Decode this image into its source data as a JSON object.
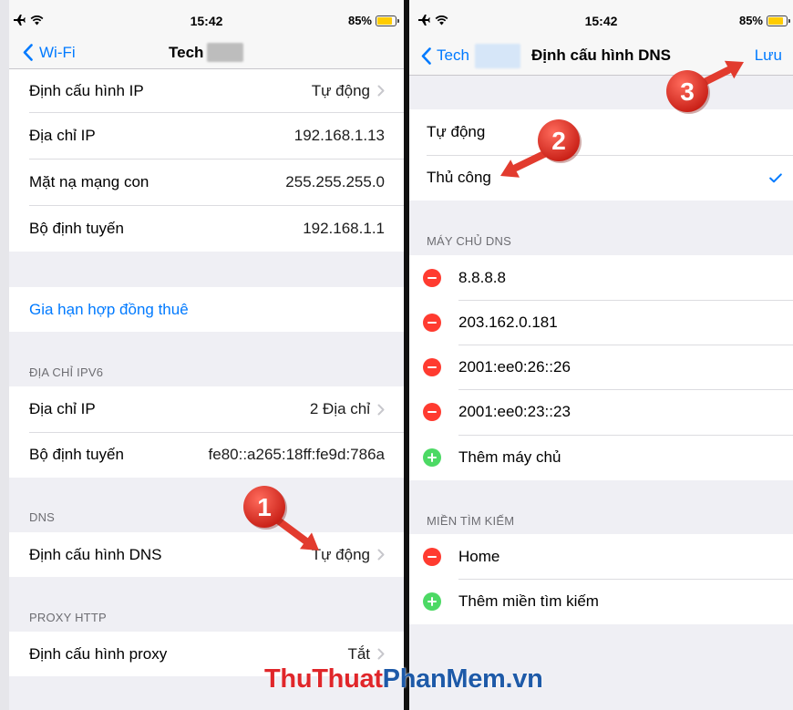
{
  "colors": {
    "ios_blue": "#007aff",
    "delete_red": "#ff3b30",
    "add_green": "#4cd964",
    "annotation_red": "#e23b2e",
    "battery_yellow": "#ffcc00",
    "group_background": "#efeff4",
    "section_header_gray": "#6d6d72",
    "watermark_red": "#e0262a",
    "watermark_blue": "#1e5aa8"
  },
  "icons": {
    "status_bar": [
      "airplane-mode-icon",
      "wifi-icon",
      "battery-icon"
    ],
    "navigation": [
      "chevron-left-icon",
      "chevron-right-icon",
      "checkmark-icon"
    ],
    "editing": [
      "delete-minus-icon",
      "add-plus-icon"
    ]
  },
  "left": {
    "status_bar": {
      "time": "15:42",
      "battery": "85%",
      "battery_level": 0.85
    },
    "nav": {
      "back_label": "Wi-Fi",
      "title": "Tech"
    },
    "ip_rows": [
      {
        "label": "Định cấu hình IP",
        "value": "Tự động"
      },
      {
        "label": "Địa chỉ IP",
        "value": "192.168.1.13"
      },
      {
        "label": "Mặt nạ mạng con",
        "value": "255.255.255.0"
      },
      {
        "label": "Bộ định tuyến",
        "value": "192.168.1.1"
      }
    ],
    "renew_lease_label": "Gia hạn hợp đồng thuê",
    "ipv6": {
      "header": "ĐỊA CHỈ IPV6",
      "rows": [
        {
          "label": "Địa chỉ IP",
          "value": "2 Địa chỉ"
        },
        {
          "label": "Bộ định tuyến",
          "value": "fe80::a265:18ff:fe9d:786a"
        }
      ]
    },
    "dns": {
      "header": "DNS",
      "row": {
        "label": "Định cấu hình DNS",
        "value": "Tự động"
      }
    },
    "proxy": {
      "header": "PROXY HTTP",
      "row": {
        "label": "Định cấu hình proxy",
        "value": "Tắt"
      }
    }
  },
  "right": {
    "status_bar": {
      "time": "15:42",
      "battery": "85%",
      "battery_level": 0.85
    },
    "nav": {
      "back_label": "Tech",
      "title": "Định cấu hình DNS",
      "save_label": "Lưu"
    },
    "mode_options": [
      {
        "label": "Tự động",
        "selected": false
      },
      {
        "label": "Thủ công",
        "selected": true
      }
    ],
    "dns_servers": {
      "header": "MÁY CHỦ DNS",
      "servers": [
        "8.8.8.8",
        "203.162.0.181",
        "2001:ee0:26::26",
        "2001:ee0:23::23"
      ],
      "add_label": "Thêm máy chủ"
    },
    "search_domains": {
      "header": "MIỀN TÌM KIẾM",
      "domains": [
        "Home"
      ],
      "add_label": "Thêm miền tìm kiếm"
    }
  },
  "annotations": {
    "steps": [
      "1",
      "2",
      "3"
    ]
  },
  "watermark": {
    "part1": "ThuThuat",
    "part2": "PhanMem",
    "part3": ".vn"
  }
}
